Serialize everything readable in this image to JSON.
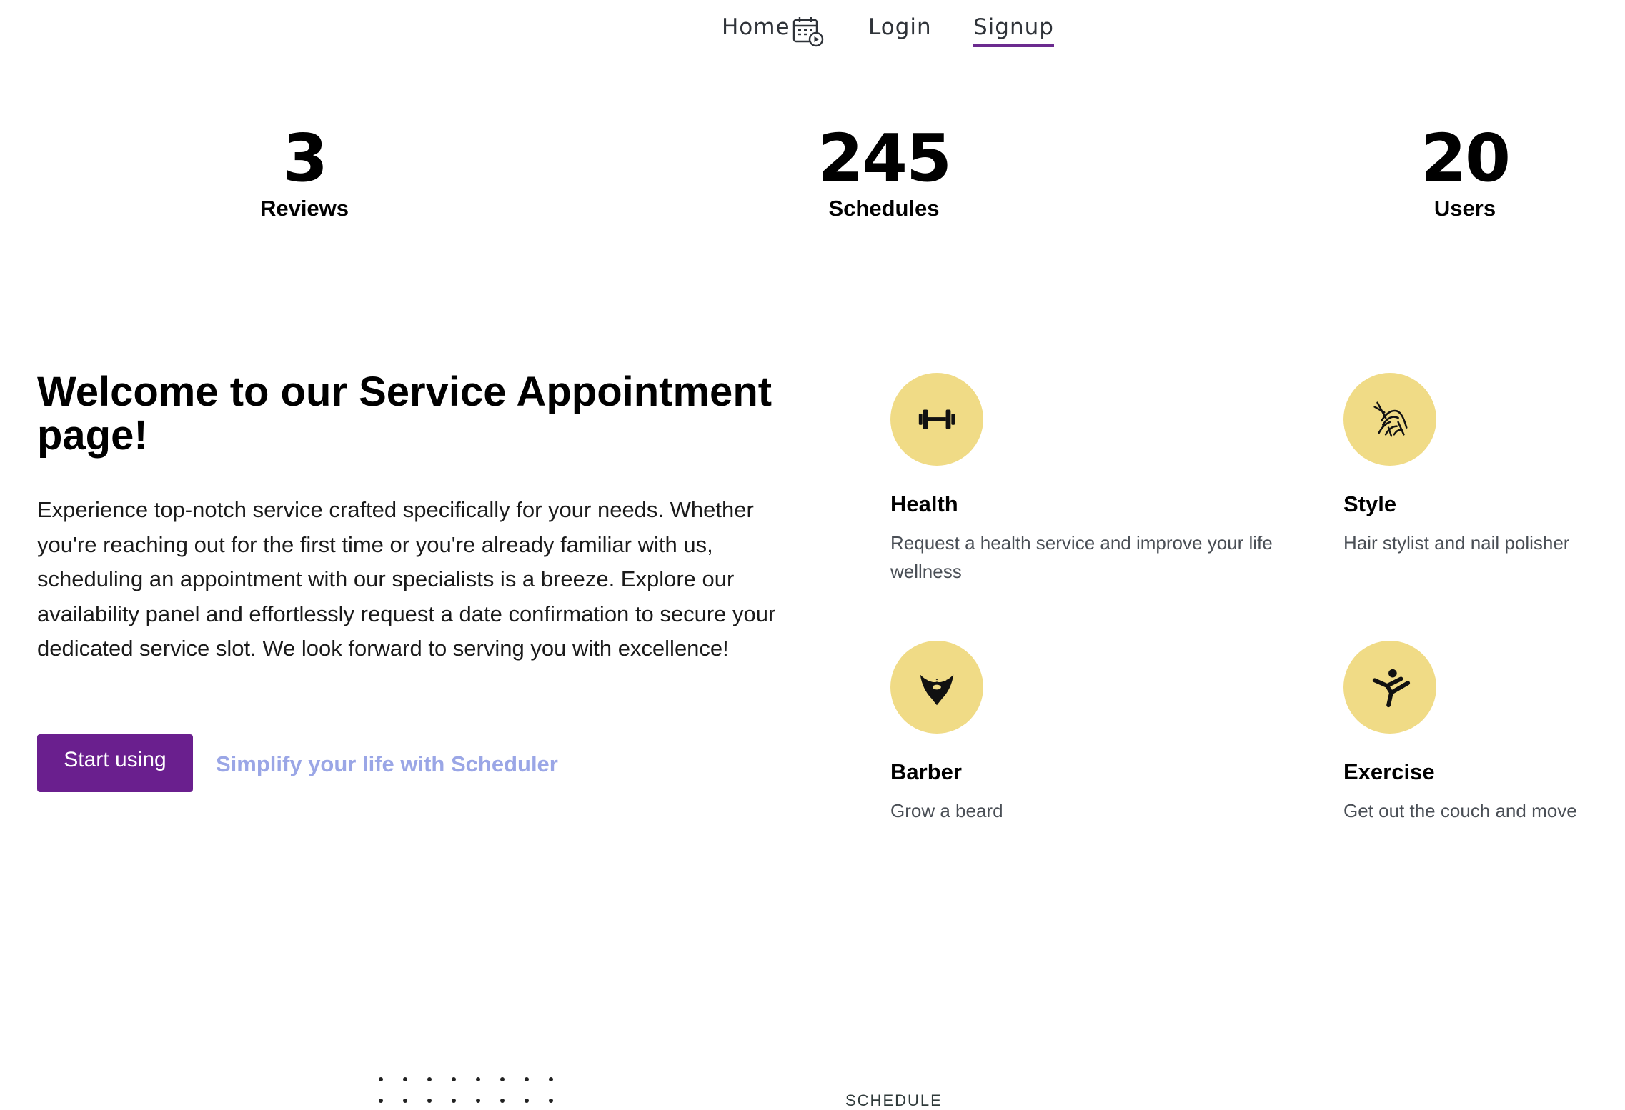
{
  "nav": {
    "home_label": "Home",
    "login_label": "Login",
    "signup_label": "Signup",
    "home_icon": "calendar-play-icon",
    "active_color": "#6b2a8f"
  },
  "stats": [
    {
      "value": "3",
      "label": "Reviews"
    },
    {
      "value": "245",
      "label": "Schedules"
    },
    {
      "value": "20",
      "label": "Users"
    }
  ],
  "hero": {
    "title": "Welcome to our Service Appointment page!",
    "text": "Experience top-notch service crafted specifically for your needs. Whether you're reaching out for the first time or you're already familiar with us, scheduling an appointment with our specialists is a breeze. Explore our availability panel and effortlessly request a date confirmation to secure your dedicated service slot. We look forward to serving you with excellence!",
    "start_button": "Start using",
    "link_text": "Simplify your life with Scheduler",
    "button_color": "#6a1f8e",
    "link_color": "#9aa6e6"
  },
  "services": [
    {
      "title": "Health",
      "desc": "Request a health service and improve your life wellness",
      "icon": "dumbbell-icon"
    },
    {
      "title": "Style",
      "desc": "Hair stylist and nail polisher",
      "icon": "hair-style-icon"
    },
    {
      "title": "Barber",
      "desc": "Grow a beard",
      "icon": "beard-icon"
    },
    {
      "title": "Exercise",
      "desc": "Get out the couch and move",
      "icon": "kick-exercise-icon"
    }
  ],
  "services_icon_bg": "#f0db86",
  "footer": {
    "section_label": "SCHEDULE"
  }
}
